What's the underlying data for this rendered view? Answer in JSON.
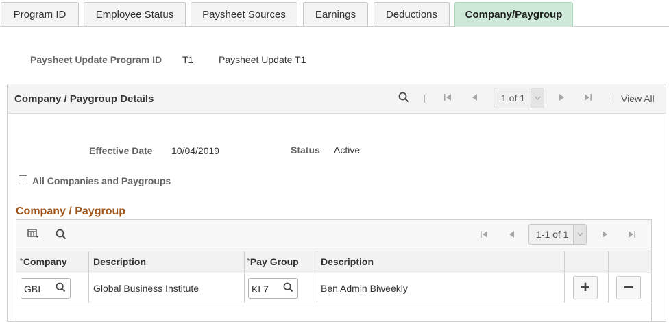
{
  "tabs": [
    {
      "label": "Program ID",
      "active": false
    },
    {
      "label": "Employee Status",
      "active": false
    },
    {
      "label": "Paysheet Sources",
      "active": false
    },
    {
      "label": "Earnings",
      "active": false
    },
    {
      "label": "Deductions",
      "active": false
    },
    {
      "label": "Company/Paygroup",
      "active": true
    }
  ],
  "header": {
    "program_label": "Paysheet Update Program ID",
    "program_id": "T1",
    "program_desc": "Paysheet Update T1"
  },
  "details": {
    "title": "Company / Paygroup Details",
    "pager": "1 of 1",
    "view_all": "View All",
    "effective_date_label": "Effective Date",
    "effective_date": "10/04/2019",
    "status_label": "Status",
    "status": "Active",
    "all_companies_label": "All Companies and Paygroups",
    "all_companies_checked": false
  },
  "grid": {
    "title": "Company / Paygroup",
    "pager": "1-1 of 1",
    "required_marker": "*",
    "columns": [
      "Company",
      "Description",
      "Pay Group",
      "Description"
    ],
    "rows": [
      {
        "company": "GBI",
        "company_desc": "Global Business Institute",
        "pay_group": "KL7",
        "pay_group_desc": "Ben Admin Biweekly"
      }
    ],
    "add_label": "+",
    "delete_label": "−"
  },
  "colors": {
    "active_tab": "#cfe9d9",
    "section_title": "#a0561a",
    "label_gray": "#666666"
  }
}
